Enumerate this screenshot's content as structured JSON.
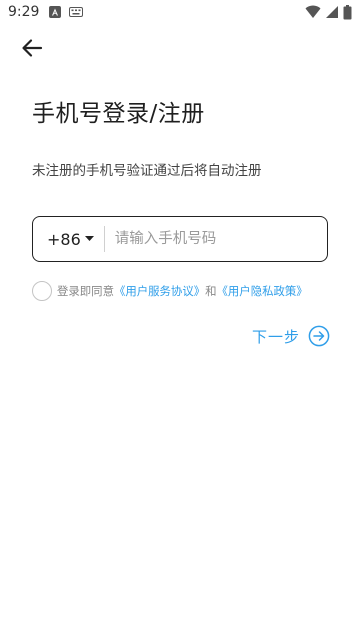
{
  "status_bar": {
    "time": "9:29",
    "left_icons": [
      "a-notification-icon",
      "keyboard-icon"
    ],
    "right_icons": [
      "wifi-icon",
      "signal-icon",
      "battery-icon"
    ]
  },
  "nav": {
    "back_icon": "arrow-left-icon"
  },
  "page": {
    "title": "手机号登录/注册",
    "subtitle": "未注册的手机号验证通过后将自动注册"
  },
  "phone": {
    "country_code": "+86",
    "placeholder": "请输入手机号码",
    "value": ""
  },
  "agreement": {
    "prefix": "登录即同意",
    "user_agreement": "《用户服务协议》",
    "conjunction": "和",
    "privacy_policy": "《用户隐私政策》",
    "checked": false
  },
  "next": {
    "label": "下一步",
    "icon": "arrow-right-circle-icon"
  },
  "colors": {
    "accent": "#2f9ee9",
    "text_primary": "#1f1f1f",
    "text_secondary": "#888888"
  }
}
